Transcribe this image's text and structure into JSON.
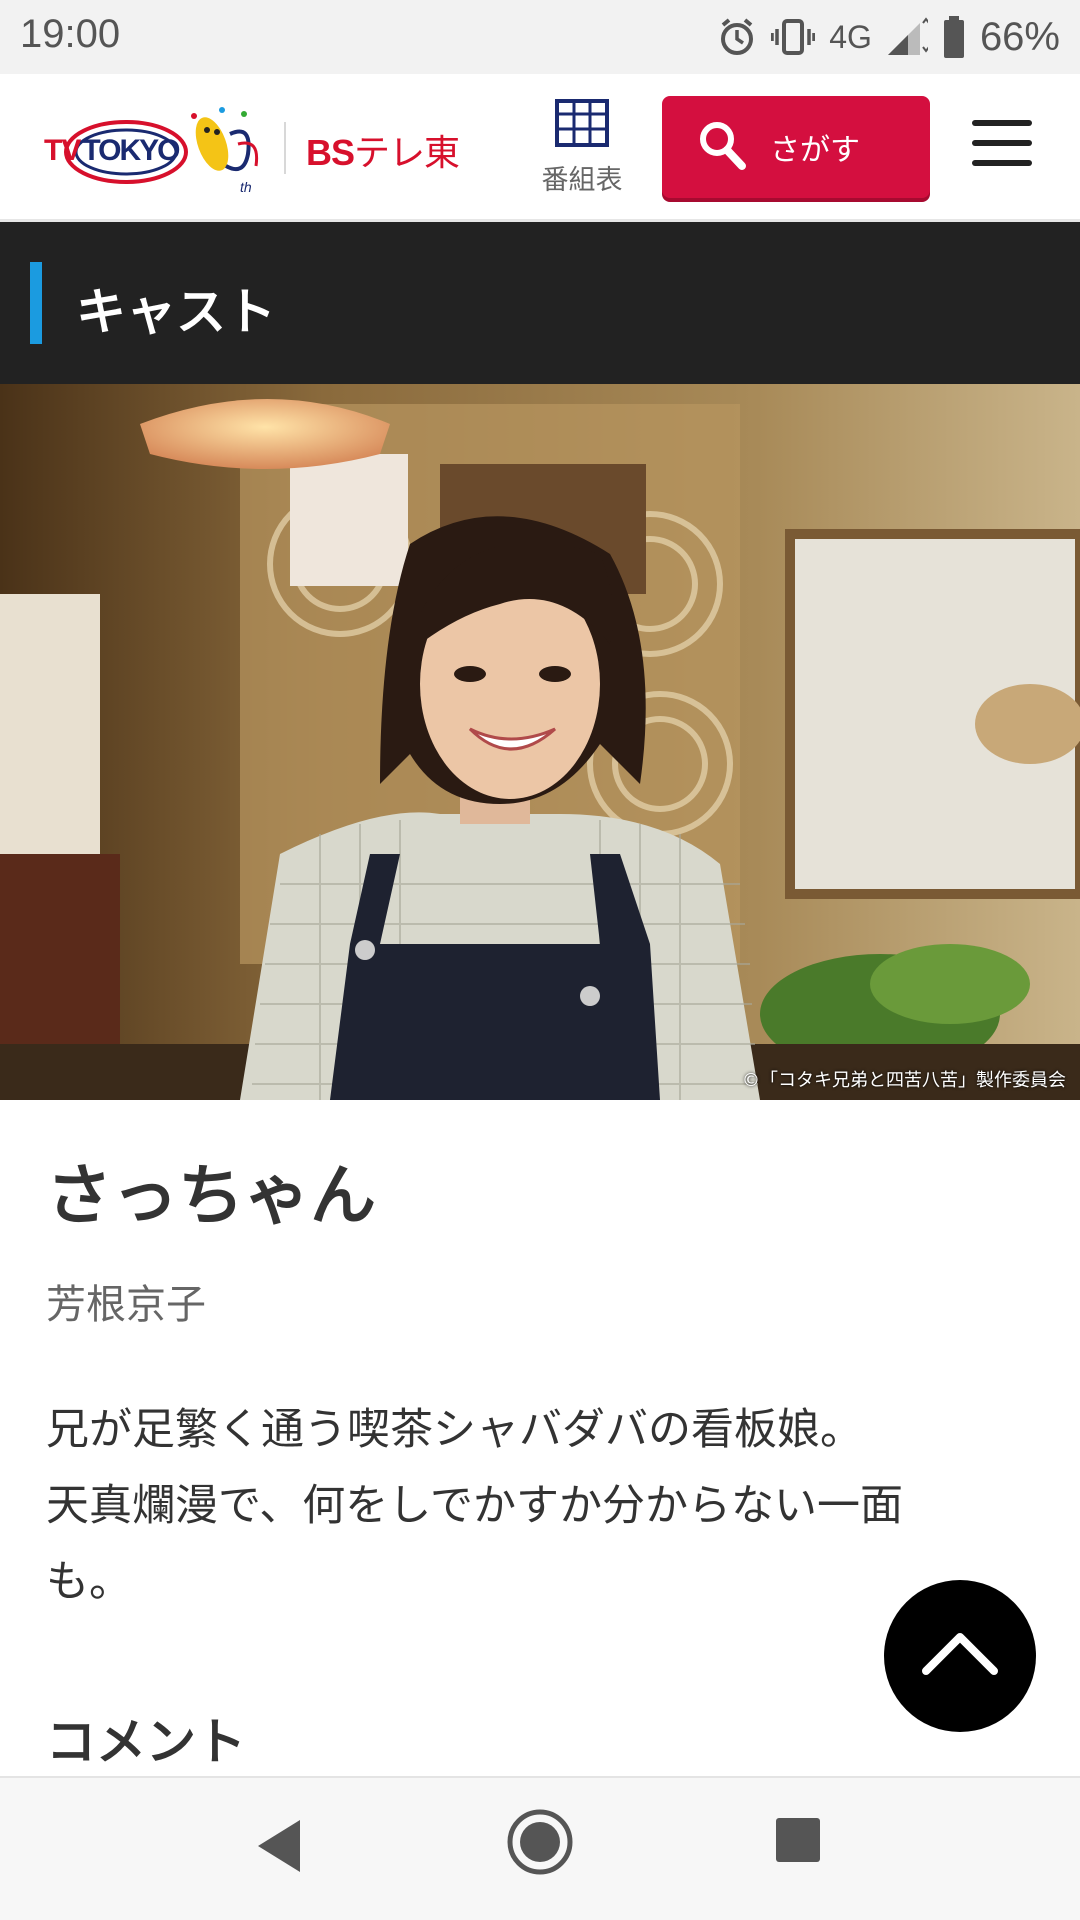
{
  "status_bar": {
    "time": "19:00",
    "network": "4G",
    "battery": "66%",
    "icons": [
      "alarm-icon",
      "vibrate-icon",
      "signal-icon",
      "battery-icon"
    ]
  },
  "header": {
    "logo_tv": "TV",
    "logo_tokyo": "TOKYO",
    "logo_bs": "BS",
    "logo_bs_rest": "テレ東",
    "schedule_label": "番組表",
    "search_label": "さがす",
    "icons": [
      "schedule-grid-icon",
      "search-icon",
      "menu-icon"
    ]
  },
  "section": {
    "title": "キャスト",
    "accent_color": "#1b9be0"
  },
  "photo": {
    "copyright": "©「コタキ兄弟と四苦八苦」製作委員会"
  },
  "character": {
    "name": "さっちゃん",
    "actor": "芳根京子",
    "description_lines": [
      "兄が足繁く通う喫茶シャバダバの看板娘。",
      "天真爛漫で、何をしでかすか分からない一面",
      "も。"
    ]
  },
  "comment": {
    "heading": "コメント"
  },
  "colors": {
    "brand_red": "#d40f3f",
    "section_bg": "#222222"
  },
  "nav": {
    "icons": [
      "back-icon",
      "home-icon",
      "recents-icon"
    ]
  }
}
